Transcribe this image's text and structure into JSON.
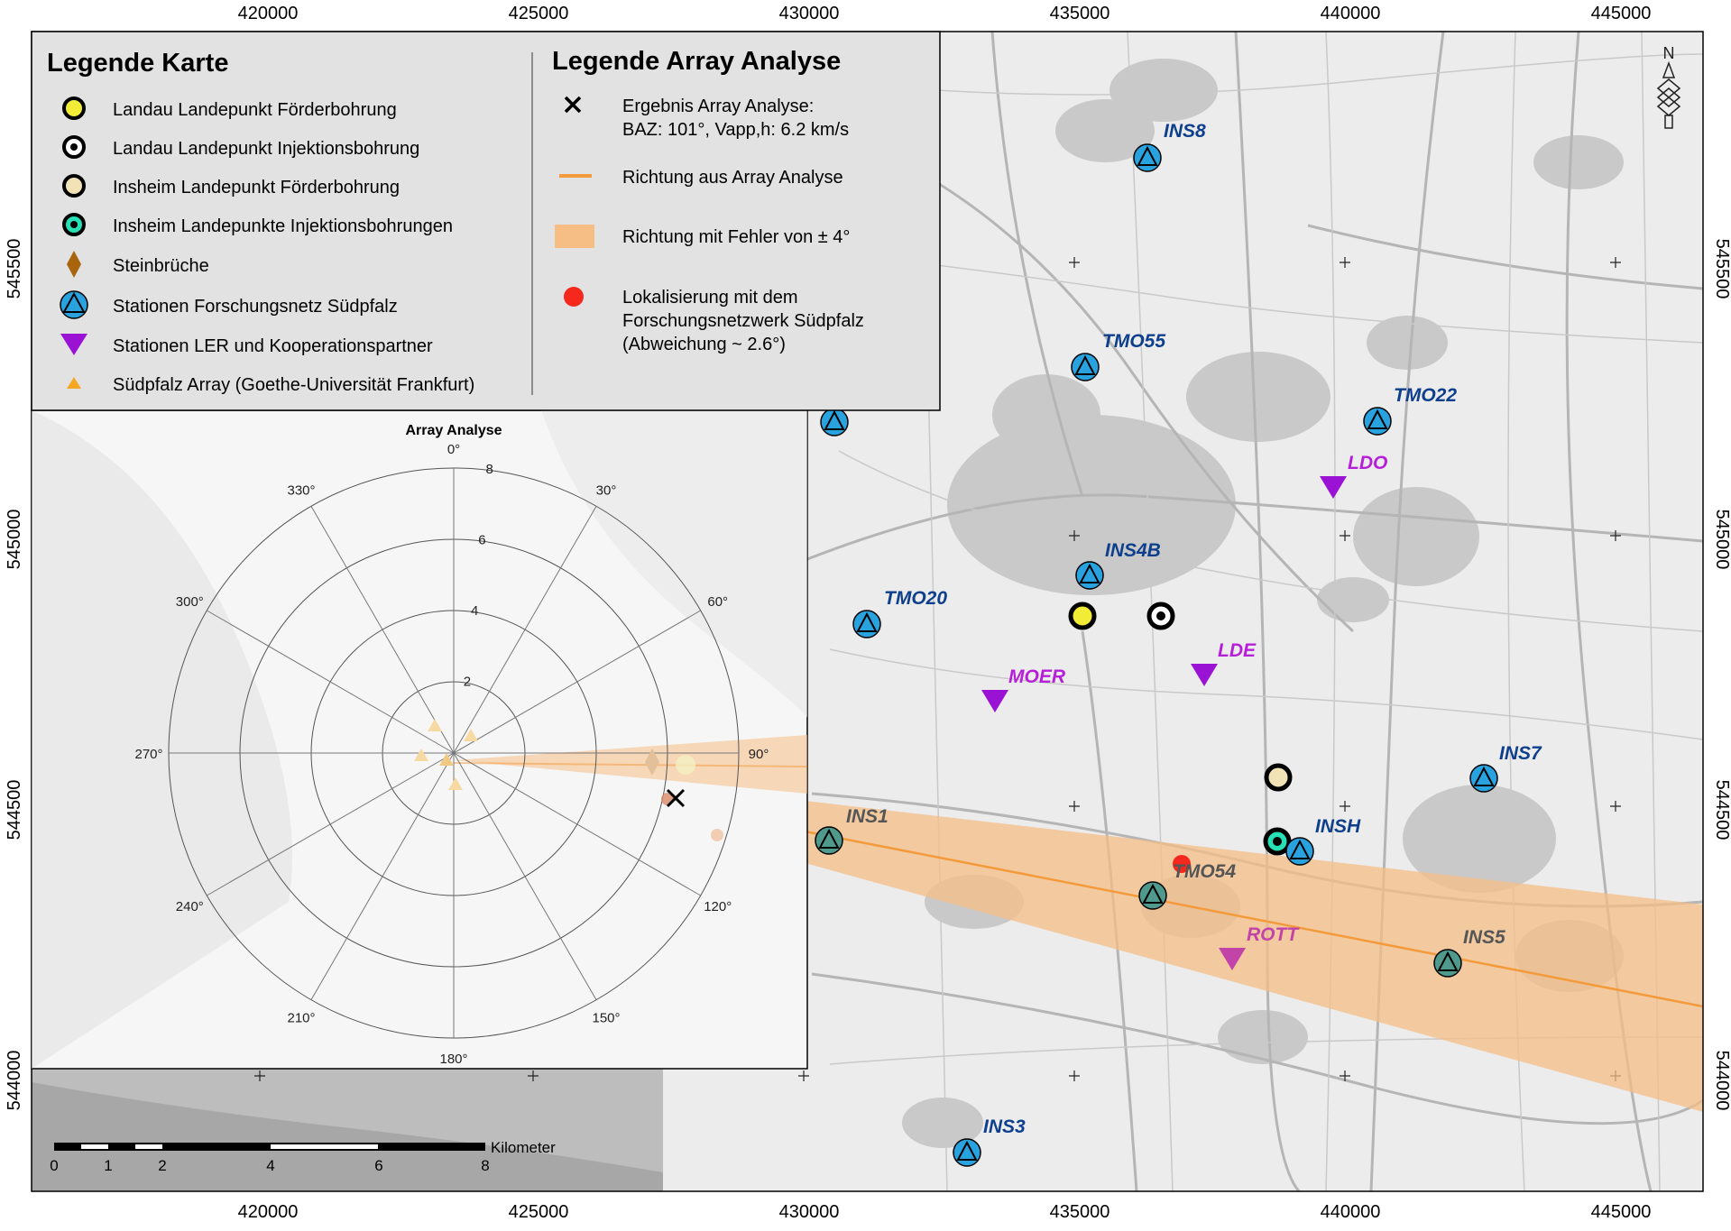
{
  "map": {
    "x_ticks": [
      "420000",
      "425000",
      "430000",
      "435000",
      "440000",
      "445000"
    ],
    "y_ticks": [
      "545500",
      "545000",
      "544500",
      "544000"
    ],
    "north_label": "N",
    "colors": {
      "station_blue": "#29a3e0",
      "station_purple": "#9a12d4",
      "station_label_blue": "#0d3f8c",
      "station_label_purple": "#b51fd8",
      "array_direction": "#f39a3c",
      "array_error": "#f6bd85",
      "localization": "#f5281e"
    },
    "stations_blue": [
      "INS8",
      "TMO55",
      "TMO22",
      "INS4B",
      "TMO20",
      "INS7",
      "INS1",
      "INSH",
      "TMO54",
      "INS5",
      "INS3"
    ],
    "stations_purple": [
      "LDO",
      "LDE",
      "MOER",
      "ROTT"
    ]
  },
  "legend_karte": {
    "title": "Legende Karte",
    "items": [
      "Landau Landepunkt Förderbohrung",
      "Landau Landepunkt Injektionsbohrung",
      "Insheim Landepunkt Förderbohrung",
      "Insheim Landepunkte Injektionsbohrungen",
      "Steinbrüche",
      "Stationen Forschungsnetz Südpfalz",
      "Stationen LER und Kooperationspartner",
      "Südpfalz Array (Goethe-Universität Frankfurt)"
    ]
  },
  "legend_array": {
    "title": "Legende Array Analyse",
    "result_line1": "Ergebnis Array Analyse:",
    "result_line2": "BAZ: 101°, Vapp,h: 6.2 km/s",
    "direction": "Richtung aus Array Analyse",
    "error": "Richtung mit Fehler von ± 4°",
    "loc_line1": "Lokalisierung mit dem",
    "loc_line2": "Forschungsnetzwerk Südpfalz",
    "loc_line3": "(Abweichung ~ 2.6°)"
  },
  "inset": {
    "title": "Array Analyse",
    "azimuth_labels": [
      "0°",
      "30°",
      "60°",
      "90°",
      "120°",
      "150°",
      "180°",
      "210°",
      "240°",
      "270°",
      "300°",
      "330°"
    ],
    "radial_labels": [
      "2",
      "4",
      "6",
      "8"
    ]
  },
  "scalebar": {
    "unit": "Kilometer",
    "labels": [
      "0",
      "1",
      "2",
      "4",
      "6",
      "8"
    ]
  }
}
